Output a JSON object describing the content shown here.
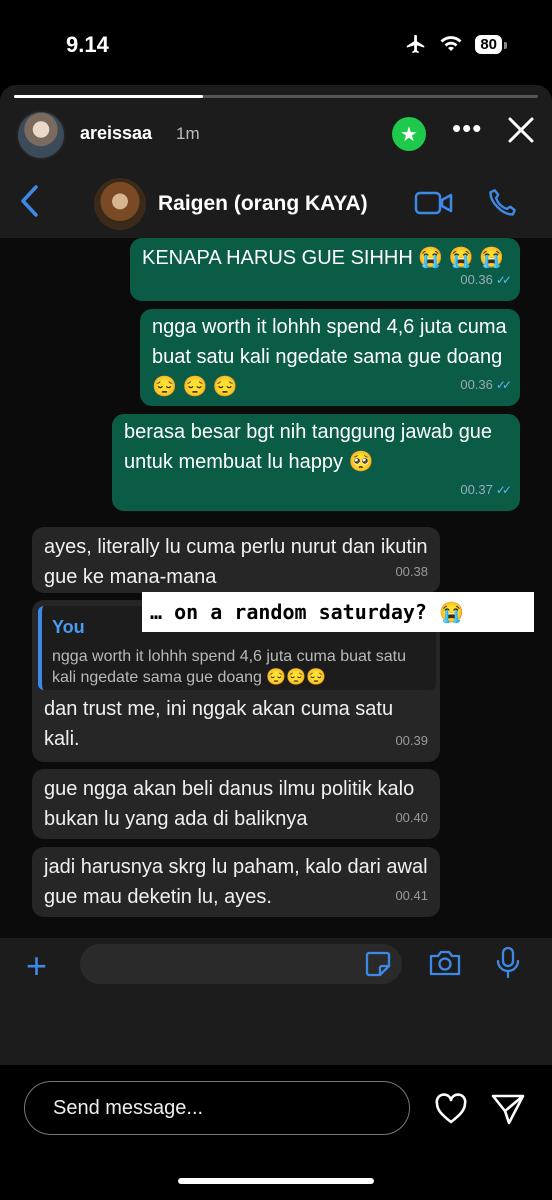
{
  "status": {
    "time": "9.14",
    "battery": "80"
  },
  "story": {
    "progress": 0.36,
    "username": "areissaa",
    "posted": "1m"
  },
  "chat": {
    "contact_name": "Raigen (orang KAYA)",
    "messages": [
      {
        "dir": "out",
        "text": "KENAPA HARUS GUE SIHHH 😭 😭 😭",
        "time": "00.36"
      },
      {
        "dir": "out",
        "text": "ngga worth it lohhh spend 4,6 juta cuma buat satu kali ngedate sama gue doang 😔 😔 😔",
        "time": "00.36"
      },
      {
        "dir": "out",
        "text": "berasa besar bgt nih tanggung jawab gue untuk membuat lu happy 🥺",
        "time": "00.37"
      },
      {
        "dir": "in",
        "text": "ayes, literally lu cuma perlu nurut dan ikutin gue ke mana-mana",
        "time": "00.38"
      },
      {
        "dir": "in",
        "quote_name": "You",
        "quote_text": "ngga worth it lohhh spend 4,6 juta cuma buat satu kali ngedate sama gue doang 😔😔😔",
        "text": "dan trust me, ini nggak akan cuma satu kali.",
        "time": "00.39"
      },
      {
        "dir": "in",
        "text": "gue ngga akan beli danus ilmu politik kalo bukan lu yang ada di baliknya",
        "time": "00.40"
      },
      {
        "dir": "in",
        "text": "jadi harusnya skrg lu paham, kalo dari awal gue mau deketin lu, ayes.",
        "time": "00.41"
      }
    ],
    "caption": "… on a random saturday? 😭"
  },
  "reply": {
    "placeholder": "Send message..."
  },
  "colors": {
    "outgoing": "#0b5c46",
    "incoming": "#262626",
    "accent": "#3f89e6",
    "star": "#1ec94c"
  }
}
